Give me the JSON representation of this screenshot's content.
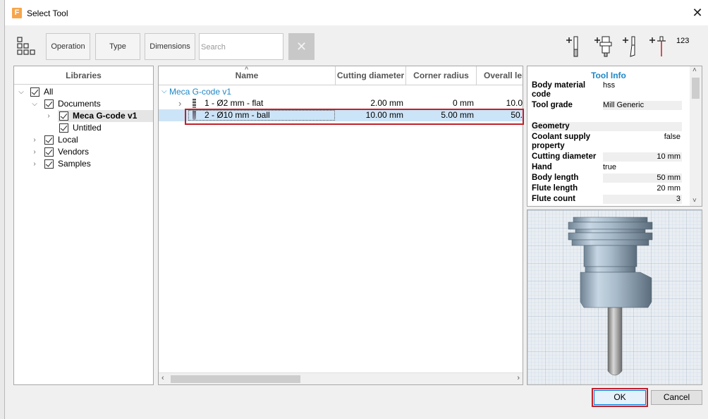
{
  "window": {
    "title": "Select Tool"
  },
  "toolbar": {
    "operation_label": "Operation",
    "type_label": "Type",
    "dimensions_label": "Dimensions",
    "search_placeholder": "Search",
    "right_icons": [
      "add-tool-icon",
      "add-holder-icon",
      "add-cutter-icon",
      "add-probe-icon",
      "renumber-icon"
    ],
    "renumber_label": "123"
  },
  "libraries": {
    "header": "Libraries",
    "items": [
      {
        "label": "All",
        "expanded": true,
        "checked": true
      },
      {
        "label": "Documents",
        "expanded": true,
        "checked": true
      },
      {
        "label": "Meca G-code v1",
        "expanded": false,
        "checked": true,
        "selected": true
      },
      {
        "label": "Untitled",
        "checked": true
      },
      {
        "label": "Local",
        "expanded": false,
        "checked": true
      },
      {
        "label": "Vendors",
        "expanded": false,
        "checked": true
      },
      {
        "label": "Samples",
        "expanded": false,
        "checked": true
      }
    ]
  },
  "tools": {
    "columns": [
      "Name",
      "Cutting diameter",
      "Corner radius",
      "Overall len"
    ],
    "group": "Meca G-code v1",
    "rows": [
      {
        "name": "1 - Ø2 mm - flat",
        "diameter": "2.00 mm",
        "radius": "0 mm",
        "overall": "10.0"
      },
      {
        "name": "2 - Ø10 mm - ball",
        "diameter": "10.00 mm",
        "radius": "5.00 mm",
        "overall": "50.",
        "selected": true
      }
    ]
  },
  "tool_info": {
    "title": "Tool Info",
    "props": [
      {
        "name": "Body material code",
        "value": "hss"
      },
      {
        "name": "Tool grade",
        "value": "Mill Generic"
      },
      {
        "name": "Geometry",
        "value": ""
      },
      {
        "name": "Coolant supply property",
        "value": "false"
      },
      {
        "name": "Cutting diameter",
        "value": "10 mm"
      },
      {
        "name": "Hand",
        "value": "true"
      },
      {
        "name": "Body length",
        "value": "50 mm"
      },
      {
        "name": "Flute length",
        "value": "20 mm"
      },
      {
        "name": "Flute count",
        "value": "3"
      }
    ]
  },
  "buttons": {
    "ok": "OK",
    "cancel": "Cancel"
  },
  "colors": {
    "accent": "#1d87c7",
    "highlight": "#c0202a",
    "selection": "#cce4f7"
  }
}
